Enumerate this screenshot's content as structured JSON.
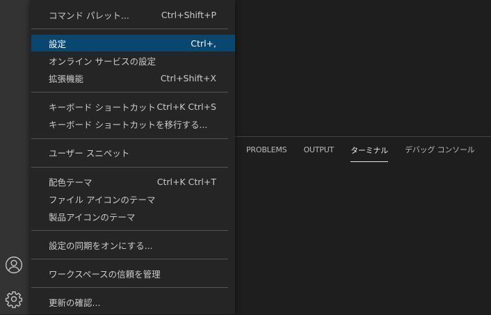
{
  "panel": {
    "tabs": [
      {
        "label": "PROBLEMS"
      },
      {
        "label": "OUTPUT"
      },
      {
        "label": "ターミナル"
      },
      {
        "label": "デバッグ コンソール"
      }
    ],
    "active_tab": "ターミナル"
  },
  "menu": {
    "items": [
      {
        "label": "コマンド パレット...",
        "shortcut": "Ctrl+Shift+P"
      },
      {
        "label": "設定",
        "shortcut": "Ctrl+,"
      },
      {
        "label": "オンライン サービスの設定",
        "shortcut": ""
      },
      {
        "label": "拡張機能",
        "shortcut": "Ctrl+Shift+X"
      },
      {
        "label": "キーボード ショートカット",
        "shortcut": "Ctrl+K Ctrl+S"
      },
      {
        "label": "キーボード ショートカットを移行する...",
        "shortcut": ""
      },
      {
        "label": "ユーザー スニペット",
        "shortcut": ""
      },
      {
        "label": "配色テーマ",
        "shortcut": "Ctrl+K Ctrl+T"
      },
      {
        "label": "ファイル アイコンのテーマ",
        "shortcut": ""
      },
      {
        "label": "製品アイコンのテーマ",
        "shortcut": ""
      },
      {
        "label": "設定の同期をオンにする...",
        "shortcut": ""
      },
      {
        "label": "ワークスペースの信頼を管理",
        "shortcut": ""
      },
      {
        "label": "更新の確認...",
        "shortcut": ""
      }
    ],
    "selected_item": "設定"
  },
  "activity_bar": {
    "icons": [
      "accounts-icon",
      "manage-gear-icon"
    ]
  },
  "colors": {
    "menu_background": "#252526",
    "selection": "#094771",
    "activity_bar": "#333333",
    "editor": "#1e1e1e"
  }
}
